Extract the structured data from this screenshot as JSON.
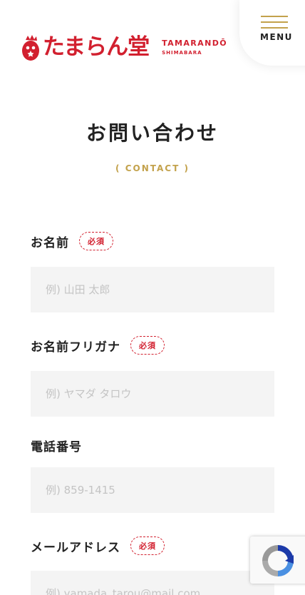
{
  "header": {
    "logo_jp": "たまらん堂",
    "logo_en": "TAMARANDŌ",
    "logo_sub": "SHIMABARA",
    "menu_label": "MENU"
  },
  "page": {
    "title": "お問い合わせ",
    "subtitle": "( CONTACT )"
  },
  "form": {
    "required_label": "必須",
    "fields": [
      {
        "label": "お名前",
        "placeholder": "例) 山田 太郎"
      },
      {
        "label": "お名前フリガナ",
        "placeholder": "例) ヤマダ タロウ"
      },
      {
        "label": "電話番号",
        "placeholder": "例) 859-1415"
      },
      {
        "label": "メールアドレス",
        "placeholder": "例) yamada_tarou@mail.com"
      }
    ]
  },
  "colors": {
    "brand_red": "#d2202f",
    "accent_gold": "#c3a24c"
  },
  "icons": {
    "logo_mark": "red-egg-logo-icon",
    "recaptcha": "recaptcha-icon"
  }
}
